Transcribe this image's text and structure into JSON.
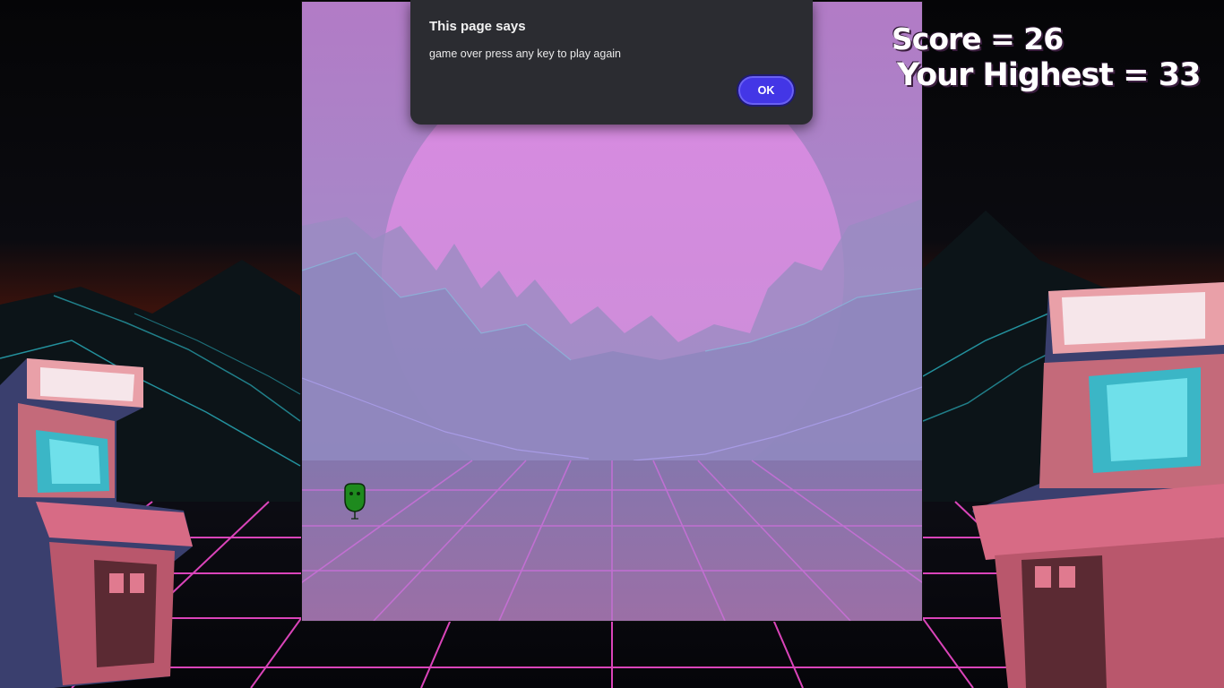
{
  "dialog": {
    "title": "This page says",
    "message": "game over press any key to play again",
    "ok_label": "OK"
  },
  "scoreboard": {
    "score_text": "Score = 26",
    "highest_text": "Your Highest = 33"
  },
  "colors": {
    "sky_top": "#b97fc9",
    "sun": "#d88be0",
    "grid_neon": "#ff4fd8",
    "mountain_outline": "#33d6e6",
    "dialog_bg": "#2b2c31",
    "ok_button": "#4336e6",
    "player": "#1e8a1e"
  },
  "icons": {
    "player": "green-blob-character",
    "arcade_left": "arcade-cabinet",
    "arcade_right": "arcade-cabinet"
  }
}
